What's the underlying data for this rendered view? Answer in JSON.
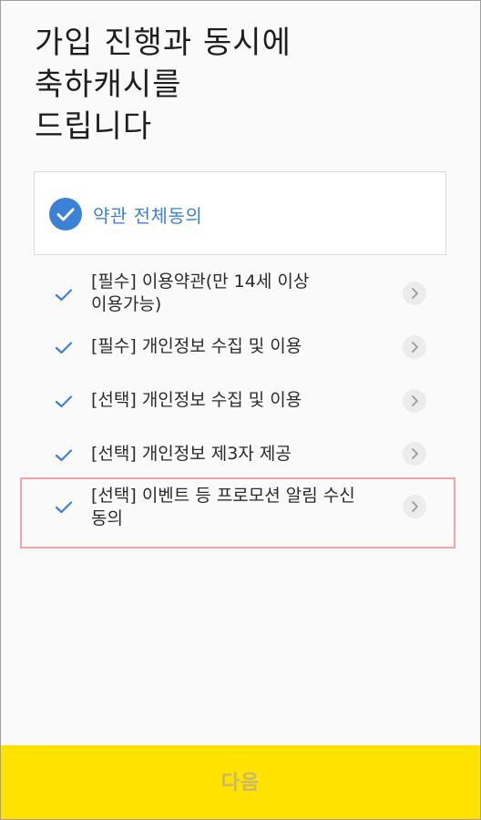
{
  "header": {
    "title_lines": [
      "가입 진행과 동시에",
      "축하캐시를",
      "드립니다"
    ]
  },
  "agree_all": {
    "label": "약관 전체동의",
    "checked": true
  },
  "terms": [
    {
      "lines": [
        "[필수] 이용약관(만 14세 이상",
        "이용가능)"
      ],
      "checked": true
    },
    {
      "lines": [
        "[필수] 개인정보 수집 및 이용"
      ],
      "checked": true
    },
    {
      "lines": [
        "[선택] 개인정보 수집 및 이용"
      ],
      "checked": true
    },
    {
      "lines": [
        "[선택] 개인정보 제3자 제공"
      ],
      "checked": true
    },
    {
      "lines": [
        "[선택] 이벤트 등 프로모션 알림 수신",
        "동의"
      ],
      "checked": true
    }
  ],
  "footer": {
    "next_label": "다음"
  },
  "colors": {
    "accent": "#3b82d6",
    "button": "#ffe200",
    "button_text": "#c8b86a",
    "highlight": "#f0a4a8"
  },
  "icons": {
    "all_check": "check-circle-icon",
    "item_check": "check-icon",
    "detail_arrow": "chevron-right-icon"
  }
}
